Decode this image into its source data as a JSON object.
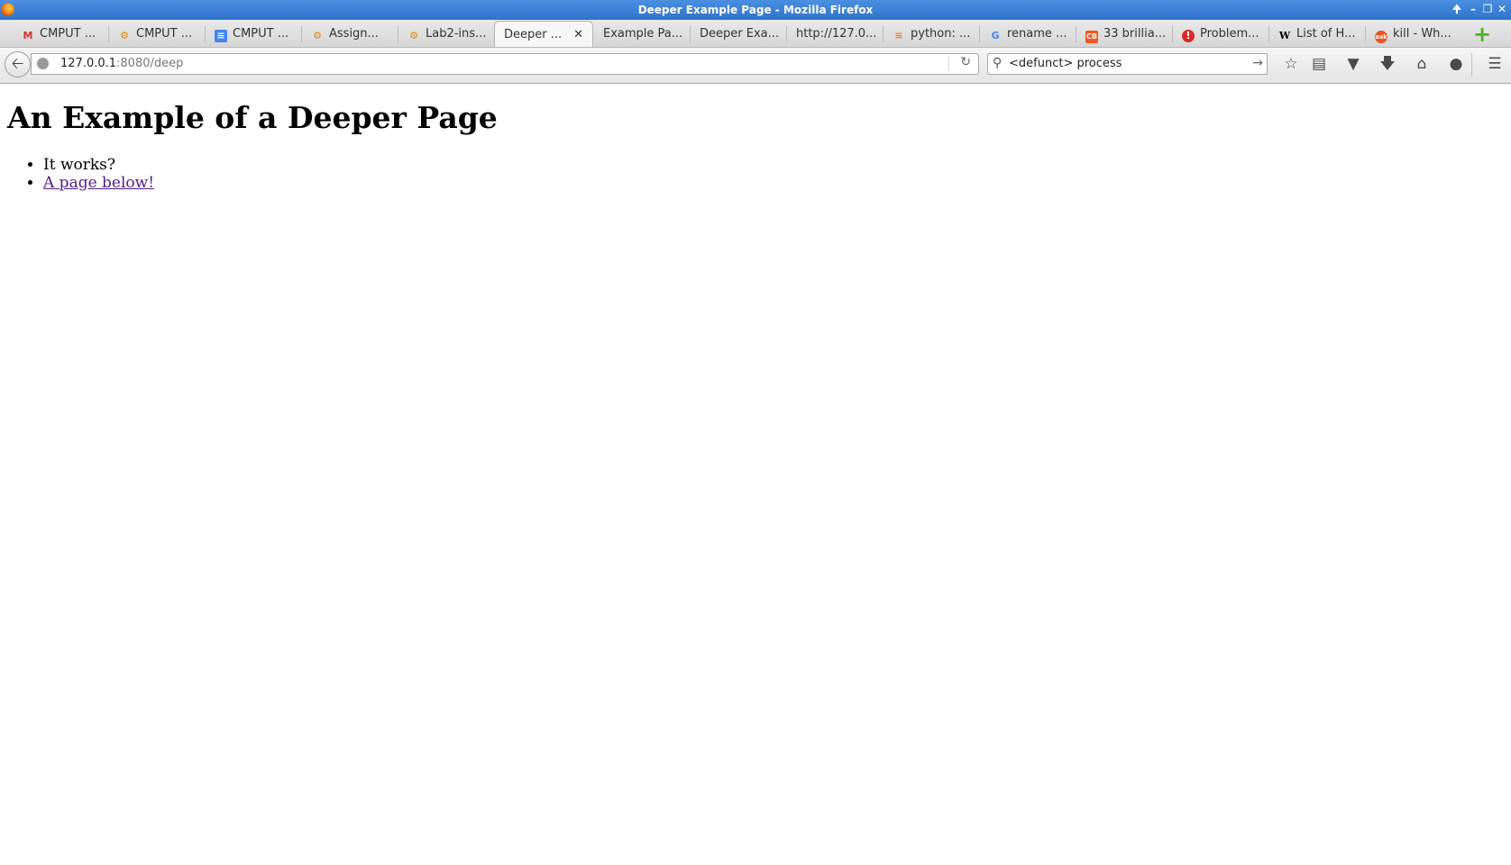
{
  "window": {
    "title": "Deeper Example Page - Mozilla Firefox",
    "controls": [
      "up-icon",
      "minimize-icon",
      "restore-icon",
      "close-icon"
    ]
  },
  "tabs": [
    {
      "label": "CMPUT ...",
      "icon": "gmail-icon",
      "active": false
    },
    {
      "label": "CMPUT ...",
      "icon": "eclass-icon",
      "active": false
    },
    {
      "label": "CMPUT ...",
      "icon": "docs-icon",
      "active": false
    },
    {
      "label": "Assign...",
      "icon": "eclass-icon",
      "active": false
    },
    {
      "label": "Lab2-ins...",
      "icon": "eclass-icon",
      "active": false
    },
    {
      "label": "Deeper ...",
      "icon": "none",
      "active": true
    },
    {
      "label": "Example Pa...",
      "icon": "none",
      "active": false
    },
    {
      "label": "Deeper Exa...",
      "icon": "none",
      "active": false
    },
    {
      "label": "http://127.0...",
      "icon": "none",
      "active": false
    },
    {
      "label": "python: ...",
      "icon": "stackoverflow-icon",
      "active": false
    },
    {
      "label": "rename ...",
      "icon": "google-icon",
      "active": false
    },
    {
      "label": "33 brillia...",
      "icon": "cb-icon",
      "active": false
    },
    {
      "label": "Problem...",
      "icon": "error-icon",
      "active": false
    },
    {
      "label": "List of H...",
      "icon": "wikipedia-icon",
      "active": false
    },
    {
      "label": "kill - Wh...",
      "icon": "askubuntu-icon",
      "active": false
    }
  ],
  "navbar": {
    "url_host": "127.0.0.1",
    "url_path": ":8080/deep",
    "search_value": "<defunct> process",
    "toolbar_icons": [
      "bookmark-star-icon",
      "reading-list-icon",
      "pocket-icon",
      "download-icon",
      "home-icon",
      "chat-icon",
      "menu-icon"
    ]
  },
  "page": {
    "heading": "An Example of a Deeper Page",
    "items": [
      {
        "text": "It works?",
        "link": false
      },
      {
        "text": "A page below!",
        "link": true
      }
    ]
  },
  "colors": {
    "titlebar": "#3b82d8",
    "visited_link": "#551a8b",
    "new_tab_plus": "#4fb02e"
  }
}
